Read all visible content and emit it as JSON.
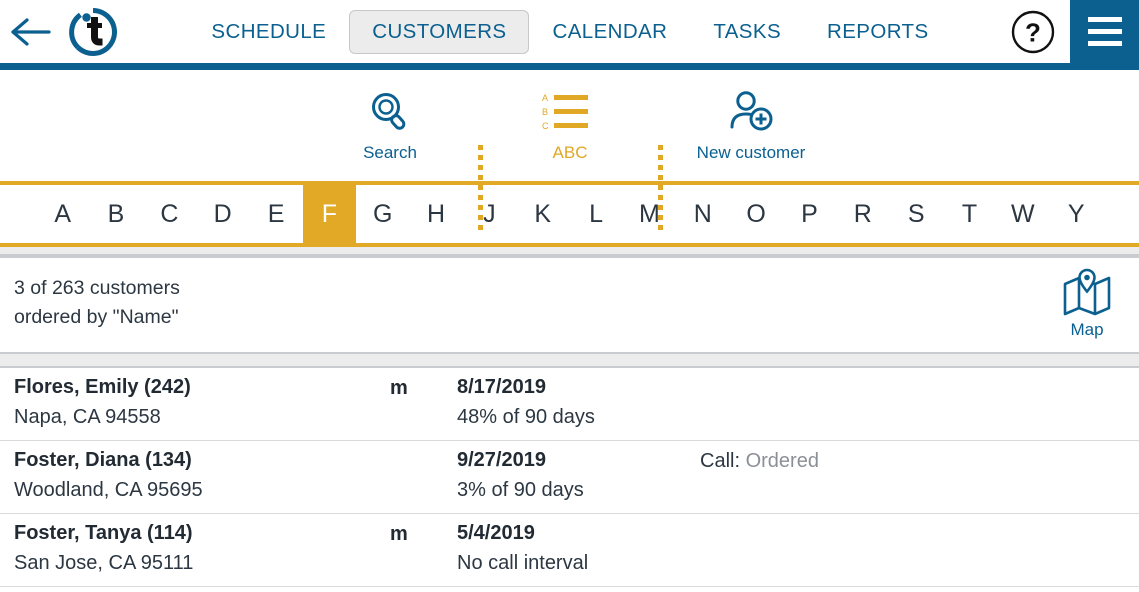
{
  "header": {
    "back_icon": "back-arrow-icon",
    "logo_letter": "t",
    "tabs": [
      {
        "label": "SCHEDULE",
        "active": false
      },
      {
        "label": "CUSTOMERS",
        "active": true
      },
      {
        "label": "CALENDAR",
        "active": false
      },
      {
        "label": "TASKS",
        "active": false
      },
      {
        "label": "REPORTS",
        "active": false
      }
    ],
    "help_label": "?",
    "menu_icon": "hamburger-menu-icon",
    "accent_blue": "#0b6090"
  },
  "toolbar": {
    "items": [
      {
        "label": "Search",
        "icon": "magnifier-icon",
        "color": "#0b6090"
      },
      {
        "label": "ABC",
        "icon": "abc-sort-icon",
        "color": "#e0a824"
      },
      {
        "label": "New customer",
        "icon": "add-person-icon",
        "color": "#0b6090"
      }
    ],
    "abc_icon_letters": [
      "A",
      "B",
      "C"
    ],
    "accent_gold": "#e2a927"
  },
  "alphabet": {
    "letters": [
      "A",
      "B",
      "C",
      "D",
      "E",
      "F",
      "G",
      "H",
      "J",
      "K",
      "L",
      "M",
      "N",
      "O",
      "P",
      "R",
      "S",
      "T",
      "W",
      "Y"
    ],
    "selected": "F"
  },
  "info": {
    "line1": "3 of 263 customers",
    "line2": "ordered by \"Name\"",
    "map_label": "Map",
    "map_icon": "map-pin-icon"
  },
  "customers": [
    {
      "name": "Flores, Emily (242)",
      "address": "Napa, CA 94558",
      "flag": "m",
      "date": "8/17/2019",
      "interval": "48% of 90 days",
      "call_label": "",
      "call_value": ""
    },
    {
      "name": "Foster, Diana (134)",
      "address": "Woodland, CA 95695",
      "flag": "",
      "date": "9/27/2019",
      "interval": "3% of 90 days",
      "call_label": "Call: ",
      "call_value": "Ordered"
    },
    {
      "name": "Foster, Tanya (114)",
      "address": "San Jose, CA 95111",
      "flag": "m",
      "date": "5/4/2019",
      "interval": "No call interval",
      "call_label": "",
      "call_value": ""
    }
  ]
}
